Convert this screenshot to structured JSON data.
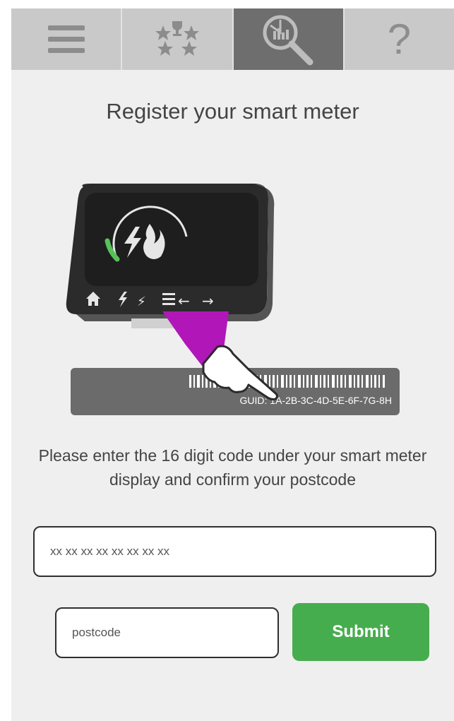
{
  "tabs": [
    {
      "name": "menu",
      "icon": "hamburger-menu-icon"
    },
    {
      "name": "achievements",
      "icon": "trophy-stars-icon"
    },
    {
      "name": "usage-search",
      "icon": "magnifier-chart-icon",
      "active": true
    },
    {
      "name": "help",
      "icon": "question-mark-icon",
      "label": "?"
    }
  ],
  "page": {
    "title": "Register your smart meter",
    "instruction": "Please enter the 16 digit code under your smart meter display and confirm your postcode"
  },
  "illustration": {
    "guid_label": "GUID: 1A-2B-3C-4D-5E-6F-7G-8H",
    "colors": {
      "device": "#2b2b2b",
      "screen": "#1e1e1e",
      "gauge_green": "#57c15a",
      "sleeve": "#b117b8",
      "label_plate": "#6b6b6b"
    }
  },
  "form": {
    "guid_placeholder": "xx xx xx xx xx xx xx xx",
    "postcode_placeholder": "postcode",
    "submit_label": "Submit"
  },
  "colors": {
    "accent": "#46ad4e",
    "tabbar": "#c9c9c9",
    "tab_active": "#6e6e6e"
  }
}
